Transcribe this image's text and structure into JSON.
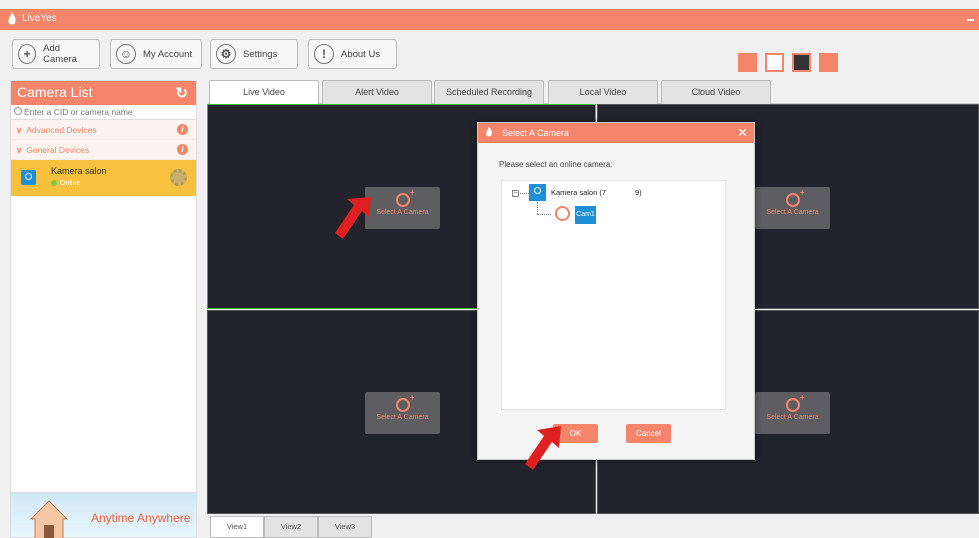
{
  "app": {
    "title": "LiveYes"
  },
  "toolbar": {
    "add_camera": "Add Camera",
    "my_account": "My Account",
    "settings": "Settings",
    "about_us": "About Us"
  },
  "sidebar": {
    "title": "Camera List",
    "search_placeholder": "Enter a CID or camera name",
    "groups": [
      {
        "label": "Advanced Devices"
      },
      {
        "label": "General Devices"
      }
    ],
    "device": {
      "name": "Kamera salon",
      "status": "Online"
    },
    "banner_text": "Anytime Anywhere"
  },
  "tabs": [
    {
      "label": "Live Video"
    },
    {
      "label": "Alert Video"
    },
    {
      "label": "Scheduled Recording"
    },
    {
      "label": "Local Video"
    },
    {
      "label": "Cloud Video"
    }
  ],
  "panes": {
    "select_label": "Select A Camera"
  },
  "view_tabs": [
    {
      "label": "View1"
    },
    {
      "label": "View2"
    },
    {
      "label": "View3"
    }
  ],
  "dialog": {
    "title": "Select A Camera",
    "prompt": "Please select an online camera:",
    "device_label": "Kamera salon (7",
    "device_suffix": "9)",
    "camera_label": "Cam1",
    "ok": "OK",
    "cancel": "Cancel"
  },
  "colors": {
    "accent": "#f4846a",
    "highlight": "#f7c03d",
    "selection": "#1e8fd9",
    "pane_bg": "#22232b"
  }
}
